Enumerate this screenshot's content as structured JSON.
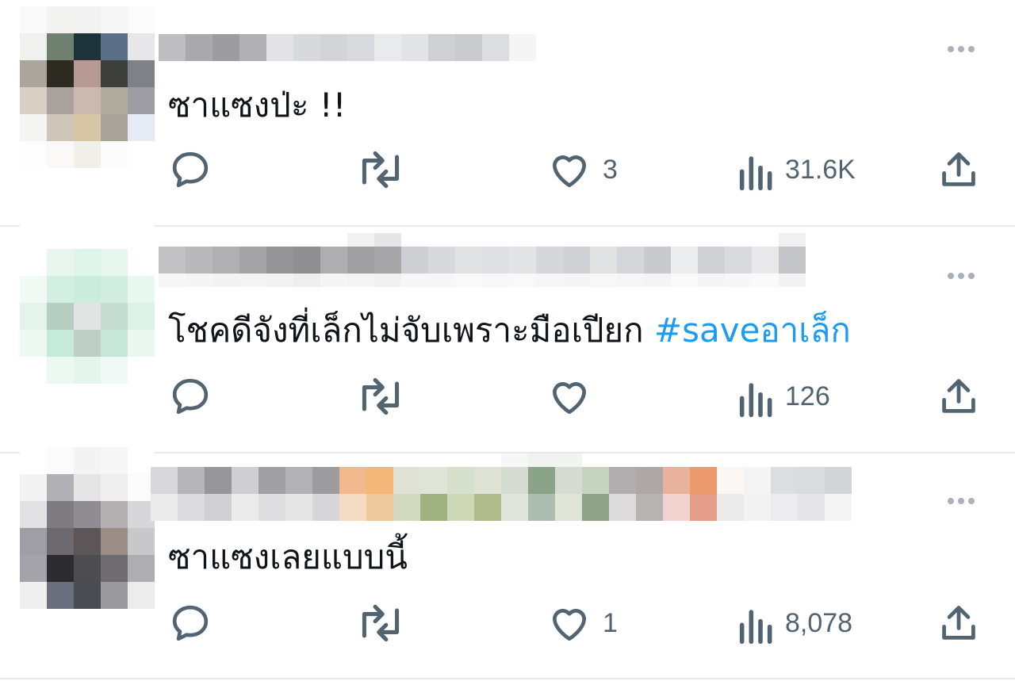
{
  "feed": {
    "tweets": [
      {
        "text": "ซาแซงป่ะ !!",
        "hashtag": "",
        "likes": "3",
        "views": "31.6K"
      },
      {
        "text": "โชคดีจังที่เล็กไม่จับเพราะมือเปียก ",
        "hashtag": "#saveอาเล็ก",
        "likes": "",
        "views": "126"
      },
      {
        "text": "ซาแซงเลยแบบนี้",
        "hashtag": "",
        "likes": "1",
        "views": "8,078"
      }
    ]
  },
  "colors": {
    "text": "#0f1419",
    "icon": "#536471",
    "hashtag": "#1d9bf0",
    "divider": "#e6e9ec"
  },
  "icons": {
    "reply": "speech-bubble-icon",
    "retweet": "retweet-arrows-icon",
    "like": "heart-outline-icon",
    "views": "bar-chart-icon",
    "share": "upload-arrow-icon",
    "more": "three-dots-icon"
  }
}
